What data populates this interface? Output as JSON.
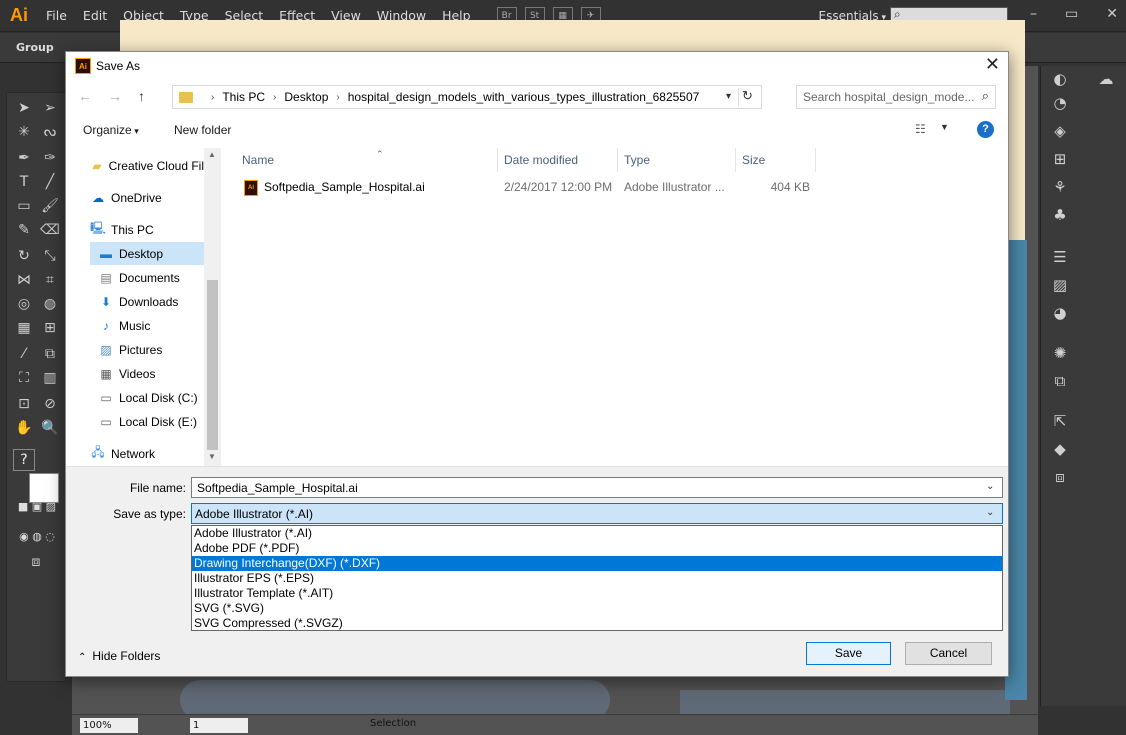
{
  "app": {
    "logo": "Ai",
    "menu": [
      "File",
      "Edit",
      "Object",
      "Type",
      "Select",
      "Effect",
      "View",
      "Window",
      "Help"
    ],
    "bridge_label": "Br",
    "stock_label": "St",
    "workspace": "Essentials",
    "control_label": "Group",
    "status": {
      "zoom": "100%",
      "artboard": "1",
      "tool": "Selection"
    }
  },
  "dialog": {
    "title": "Save As",
    "breadcrumb": [
      "This PC",
      "Desktop",
      "hospital_design_models_with_various_types_illustration_6825507"
    ],
    "search_placeholder": "Search hospital_design_mode...",
    "organize_label": "Organize",
    "new_folder_label": "New folder",
    "nav_items": [
      {
        "label": "Creative Cloud Fil",
        "icon": "creative-cloud-icon"
      },
      {
        "label": "OneDrive",
        "icon": "onedrive-icon"
      },
      {
        "label": "This PC",
        "icon": "computer-icon"
      },
      {
        "label": "Desktop",
        "icon": "desktop-icon",
        "selected": true
      },
      {
        "label": "Documents",
        "icon": "documents-icon"
      },
      {
        "label": "Downloads",
        "icon": "downloads-icon"
      },
      {
        "label": "Music",
        "icon": "music-icon"
      },
      {
        "label": "Pictures",
        "icon": "pictures-icon"
      },
      {
        "label": "Videos",
        "icon": "videos-icon"
      },
      {
        "label": "Local Disk (C:)",
        "icon": "drive-icon"
      },
      {
        "label": "Local Disk (E:)",
        "icon": "drive-icon"
      },
      {
        "label": "Network",
        "icon": "network-icon"
      }
    ],
    "columns": [
      "Name",
      "Date modified",
      "Type",
      "Size"
    ],
    "files": [
      {
        "name": "Softpedia_Sample_Hospital.ai",
        "date": "2/24/2017 12:00 PM",
        "type": "Adobe Illustrator ...",
        "size": "404 KB"
      }
    ],
    "file_name_label": "File name:",
    "file_name_value": "Softpedia_Sample_Hospital.ai",
    "save_type_label": "Save as type:",
    "save_type_value": "Adobe Illustrator (*.AI)",
    "save_type_options": [
      "Adobe Illustrator (*.AI)",
      "Adobe PDF (*.PDF)",
      "Drawing Interchange(DXF) (*.DXF)",
      "Illustrator EPS (*.EPS)",
      "Illustrator Template (*.AIT)",
      "SVG (*.SVG)",
      "SVG Compressed (*.SVGZ)"
    ],
    "highlighted_option": 2,
    "hide_folders_label": "Hide Folders",
    "save_label": "Save",
    "cancel_label": "Cancel"
  },
  "colors": {
    "accent": "#0078d7",
    "selection": "#cce4f7",
    "ai_orange": "#ff9a00"
  }
}
